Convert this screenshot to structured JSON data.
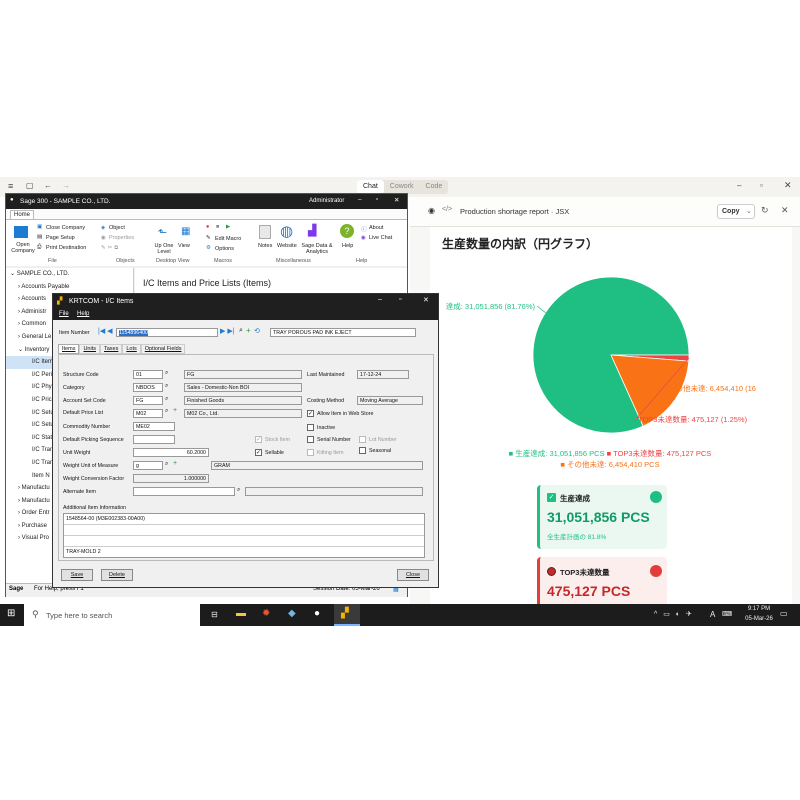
{
  "chatbar": {
    "tabs": [
      "Chat",
      "Cowork",
      "Code"
    ]
  },
  "artifact": {
    "title": "Production shortage report · JSX",
    "copy": "Copy"
  },
  "chart_data": {
    "type": "pie",
    "title": "生産数量の内訳（円グラフ）",
    "categories": [
      "生産達成",
      "TOP3未達数量",
      "その他未達"
    ],
    "values": [
      31051856,
      475127,
      6454410
    ],
    "slice_labels": [
      "達成: 31,051,856 (81.76%)",
      "TOP3未達数量: 475,127 (1.25%)",
      "その他未達: 6,454,410 (16"
    ],
    "legend": [
      "生産達成: 31,051,856 PCS",
      "TOP3未達数量: 475,127 PCS",
      "その他未達: 6,454,410 PCS"
    ],
    "colors": [
      "#1fbf83",
      "#ef4444",
      "#f97316"
    ]
  },
  "cards": [
    {
      "title": "生産達成",
      "value": "31,051,856 PCS",
      "sub": "全生産計画の 81.8%",
      "color": "#1fbf83",
      "bg": "#eaf8f1"
    },
    {
      "title": "TOP3未達数量",
      "value": "475,127 PCS",
      "color": "#e23d3d",
      "bg": "#fdeeee"
    }
  ],
  "sage": {
    "title": "Sage 300 - SAMPLE CO., LTD.",
    "user": "Administrator",
    "tab": "Home",
    "ribbon": {
      "open_company": "Open Company",
      "close_company": "Close Company",
      "page_setup": "Page Setup",
      "print_destination": "Print Destination",
      "object": "Object",
      "properties": "Properties",
      "up_one_level": "Up One Level",
      "view": "View",
      "edit_macro": "Edit Macro",
      "options": "Options",
      "notes": "Notes",
      "website": "Website",
      "sage_data": "Sage Data & Analytics",
      "help": "Help",
      "about": "About",
      "live_chat": "Live Chat",
      "groups": [
        "File",
        "Objects",
        "Desktop View",
        "Macros",
        "Miscellaneous",
        "Help"
      ]
    },
    "content_title": "I/C Items and Price Lists (Items)",
    "tree": [
      "SAMPLE CO., LTD.",
      "Accounts Payable",
      "Accounts",
      "Administr",
      "Common",
      "General Le",
      "Inventory",
      "I/C Item",
      "I/C Peri",
      "I/C Phy",
      "I/C Pric",
      "I/C Setu",
      "I/C Setu",
      "I/C Stat",
      "I/C Tran",
      "I/C Tran",
      "Item N",
      "Manufactu",
      "Manufactu",
      "Order Entr",
      "Purchase",
      "Visual Pro"
    ],
    "status_brand": "Sage",
    "status_help": "For Help, press F1",
    "session_date": "Session Date: 05-Mar-26"
  },
  "dialog": {
    "title": "KRTCOM - I/C Items",
    "menu": [
      "File",
      "Help"
    ],
    "item_number_label": "Item Number",
    "item_number": "1154896400",
    "item_desc": "TRAY POROUS PAD INK EJECT",
    "tabs": [
      "Items",
      "Units",
      "Taxes",
      "Lots",
      "Optional Fields"
    ],
    "labels": {
      "structure_code": "Structure Code",
      "category": "Category",
      "account_set": "Account Set Code",
      "price_list": "Default Price List",
      "commodity": "Commodity Number",
      "picking": "Default Picking Sequence",
      "unit_weight": "Unit Weight",
      "weight_uom": "Weight Unit of Measure",
      "wcf": "Weight Conversion Factor",
      "alt_item": "Alternate Item",
      "addl_info": "Additional Item Information",
      "last_maint": "Last Maintained",
      "costing": "Costing Method",
      "allow_web": "Allow Item in Web Store",
      "inactive": "Inactive",
      "stock_item": "Stock Item",
      "serial": "Serial Number",
      "lot": "Lot Number",
      "sellable": "Sellable",
      "kitting": "Kitting Item",
      "seasonal": "Seasonal"
    },
    "values": {
      "structure_code": "01",
      "structure_desc": "FG",
      "category": "NBDOS",
      "category_desc": "Sales - Domestic-Non BOI",
      "account_set": "FG",
      "account_desc": "Finished Goods",
      "price_list": "M02",
      "price_desc": "M02 Co., Ltd.",
      "commodity": "ME02",
      "unit_weight": "60.2000",
      "weight_uom": "g",
      "weight_uom_desc": "GRAM",
      "wcf": "1.000000",
      "last_maint": "17-12-24",
      "costing": "Moving Average",
      "addl_lines": [
        "1548564-00 (M3E002383-00A00)",
        "",
        "",
        "TRAY-MOLD 2"
      ]
    },
    "buttons": {
      "save": "Save",
      "delete": "Delete",
      "close": "Close"
    }
  },
  "taskbar": {
    "search": "Type here to search",
    "time": "9:17 PM",
    "date": "05-Mar-26",
    "lang": "A"
  }
}
